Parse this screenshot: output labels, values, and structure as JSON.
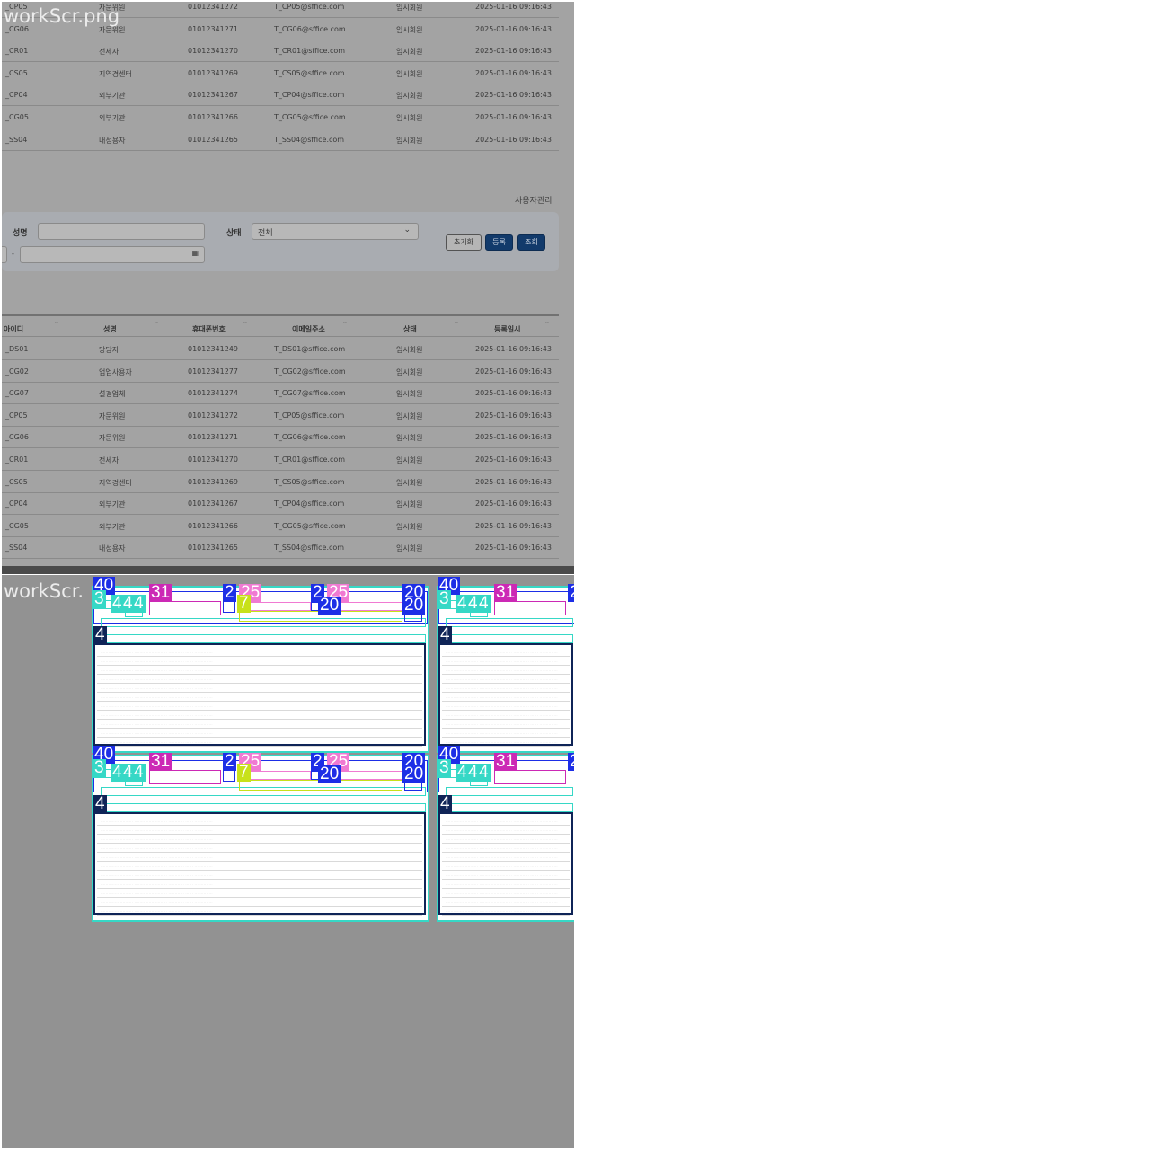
{
  "file_labels": [
    "workScr.png",
    "workScr."
  ],
  "breadcrumb": "사용자관리",
  "search": {
    "name_label": "성명",
    "status_label": "상태",
    "status_value": "전체",
    "reset_label": "초기화",
    "register_label": "등록",
    "search_label": "조회"
  },
  "table_header": [
    "아이디",
    "성명",
    "휴대폰번호",
    "이메일주소",
    "상태",
    "등록일시"
  ],
  "upper_rows": [
    [
      "_CP05",
      "자문위원",
      "01012341272",
      "T_CP05@sffice.com",
      "임시회원",
      "2025-01-16 09:16:43"
    ],
    [
      "_CG06",
      "자문위원",
      "01012341271",
      "T_CG06@sffice.com",
      "임시회원",
      "2025-01-16 09:16:43"
    ],
    [
      "_CR01",
      "전세자",
      "01012341270",
      "T_CR01@sffice.com",
      "임시회원",
      "2025-01-16 09:16:43"
    ],
    [
      "_CS05",
      "지역경센터",
      "01012341269",
      "T_CS05@sffice.com",
      "임시회원",
      "2025-01-16 09:16:43"
    ],
    [
      "_CP04",
      "외부기관",
      "01012341267",
      "T_CP04@sffice.com",
      "임시회원",
      "2025-01-16 09:16:43"
    ],
    [
      "_CG05",
      "외부기관",
      "01012341266",
      "T_CG05@sffice.com",
      "임시회원",
      "2025-01-16 09:16:43"
    ],
    [
      "_SS04",
      "내성용자",
      "01012341265",
      "T_SS04@sffice.com",
      "임시회원",
      "2025-01-16 09:16:43"
    ]
  ],
  "lower_rows": [
    [
      "_DS01",
      "당당자",
      "01012341249",
      "T_DS01@sffice.com",
      "임시회원",
      "2025-01-16 09:16:43"
    ],
    [
      "_CG02",
      "업업사용자",
      "01012341277",
      "T_CG02@sffice.com",
      "임시회원",
      "2025-01-16 09:16:43"
    ],
    [
      "_CG07",
      "설경업체",
      "01012341274",
      "T_CG07@sffice.com",
      "임시회원",
      "2025-01-16 09:16:43"
    ],
    [
      "_CP05",
      "자문위원",
      "01012341272",
      "T_CP05@sffice.com",
      "임시회원",
      "2025-01-16 09:16:43"
    ],
    [
      "_CG06",
      "자문위원",
      "01012341271",
      "T_CG06@sffice.com",
      "임시회원",
      "2025-01-16 09:16:43"
    ],
    [
      "_CR01",
      "전세자",
      "01012341270",
      "T_CR01@sffice.com",
      "임시회원",
      "2025-01-16 09:16:43"
    ],
    [
      "_CS05",
      "지역경센터",
      "01012341269",
      "T_CS05@sffice.com",
      "임시회원",
      "2025-01-16 09:16:43"
    ],
    [
      "_CP04",
      "외부기관",
      "01012341267",
      "T_CP04@sffice.com",
      "임시회원",
      "2025-01-16 09:16:43"
    ],
    [
      "_CG05",
      "외부기관",
      "01012341266",
      "T_CG05@sffice.com",
      "임시회원",
      "2025-01-16 09:16:43"
    ],
    [
      "_SS04",
      "내성용자",
      "01012341265",
      "T_SS04@sffice.com",
      "임시회원",
      "2025-01-16 09:16:43"
    ]
  ],
  "annotation_numbers": {
    "a40": "40",
    "a3": "3",
    "a4": "4",
    "a31": "31",
    "a2": "2",
    "a25": "25",
    "a20": "20",
    "a7": "7"
  },
  "colors": {
    "teal": "#36d8c6",
    "magenta": "#cc29b5",
    "blue": "#1d2ee6",
    "pink": "#f07ad2",
    "lime": "#c8e11a",
    "navy": "#0f2457"
  }
}
